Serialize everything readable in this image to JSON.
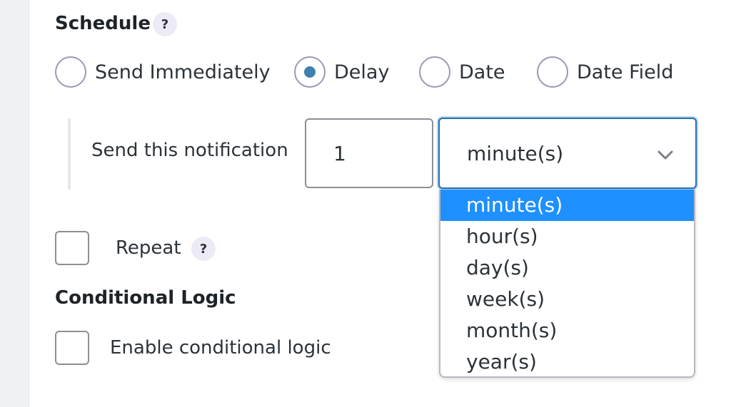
{
  "schedule": {
    "heading": "Schedule",
    "help": "?",
    "options": [
      {
        "label": "Send Immediately",
        "checked": false
      },
      {
        "label": "Delay",
        "checked": true
      },
      {
        "label": "Date",
        "checked": false
      },
      {
        "label": "Date Field",
        "checked": false
      }
    ]
  },
  "delay": {
    "label": "Send this notification",
    "amount": "1",
    "unit_selected": "minute(s)",
    "unit_options": [
      "minute(s)",
      "hour(s)",
      "day(s)",
      "week(s)",
      "month(s)",
      "year(s)"
    ]
  },
  "repeat": {
    "label": "Repeat",
    "help": "?",
    "checked": false
  },
  "conditional": {
    "heading": "Conditional Logic",
    "enable_label": "Enable conditional logic",
    "checked": false
  },
  "colors": {
    "accent": "#2271b1",
    "selected_option_bg": "#1e90ff",
    "radio_dot": "#3f80ae"
  }
}
